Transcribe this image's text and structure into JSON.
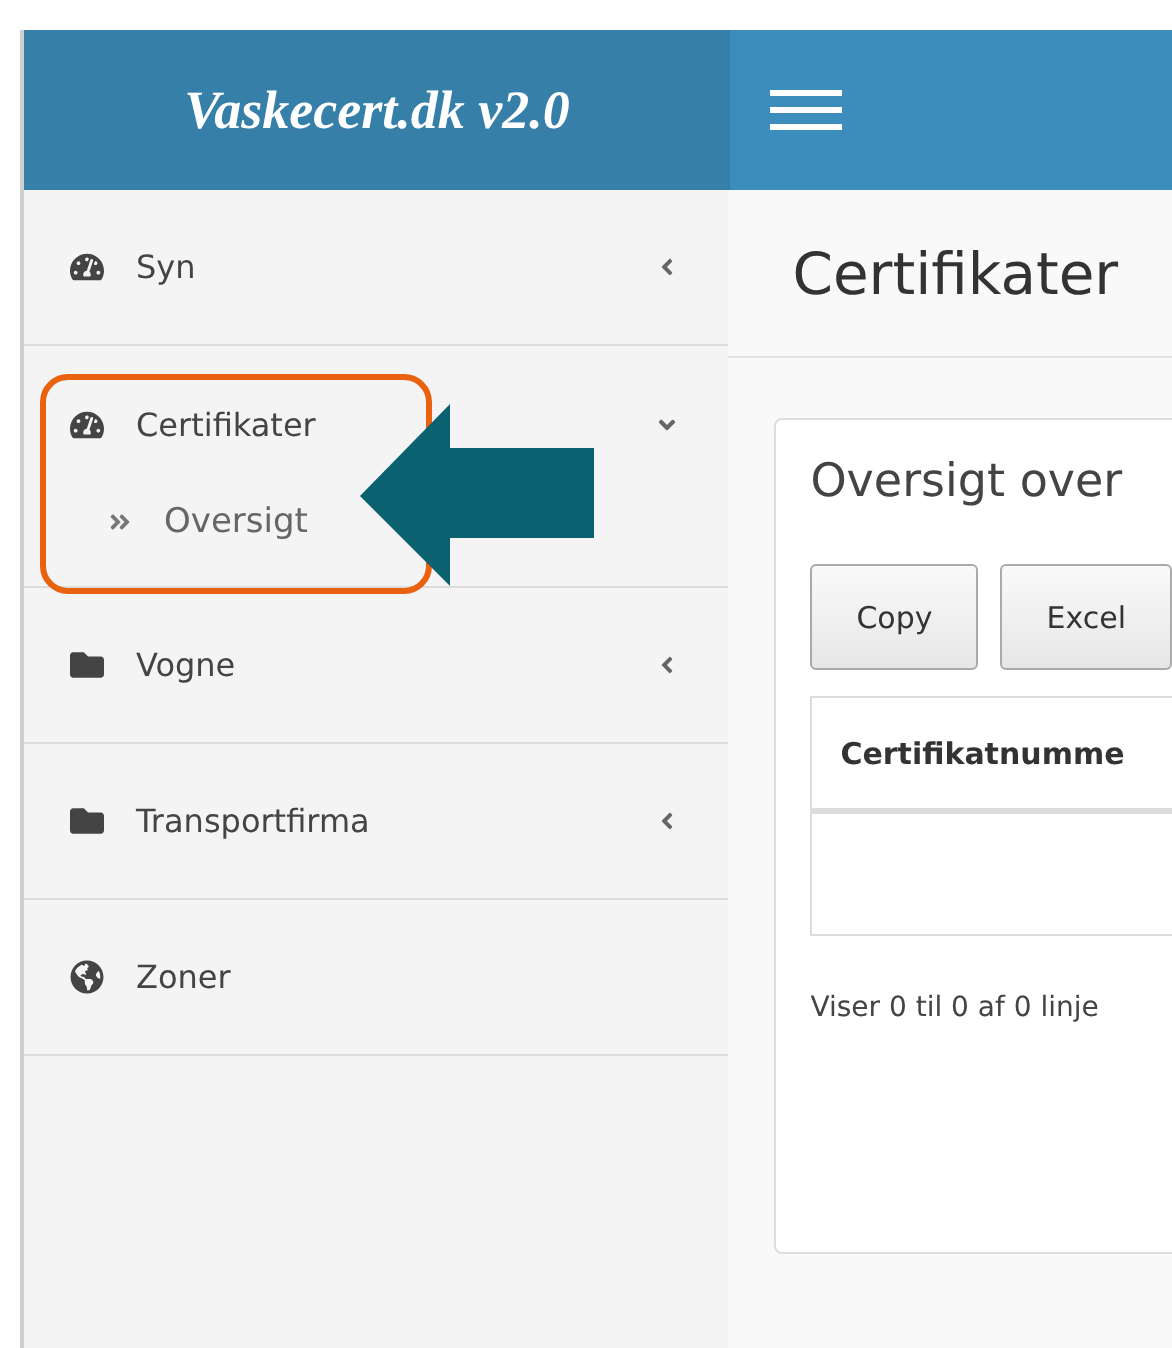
{
  "header": {
    "logo": "Vaskecert.dk v2.0"
  },
  "sidebar": {
    "items": [
      {
        "label": "Syn",
        "kind": "gauge",
        "expanded": false
      },
      {
        "label": "Certifikater",
        "kind": "gauge",
        "expanded": true,
        "children": [
          {
            "label": "Oversigt"
          }
        ]
      },
      {
        "label": "Vogne",
        "kind": "folder",
        "expanded": false
      },
      {
        "label": "Transportfirma",
        "kind": "folder",
        "expanded": false
      },
      {
        "label": "Zoner",
        "kind": "globe"
      }
    ]
  },
  "page": {
    "title": "Certifikater"
  },
  "box": {
    "title": "Oversigt over",
    "buttons": [
      "Copy",
      "Excel"
    ],
    "table": {
      "columns": [
        "Certifikatnumme"
      ]
    },
    "info": "Viser 0 til 0 af 0 linje"
  }
}
